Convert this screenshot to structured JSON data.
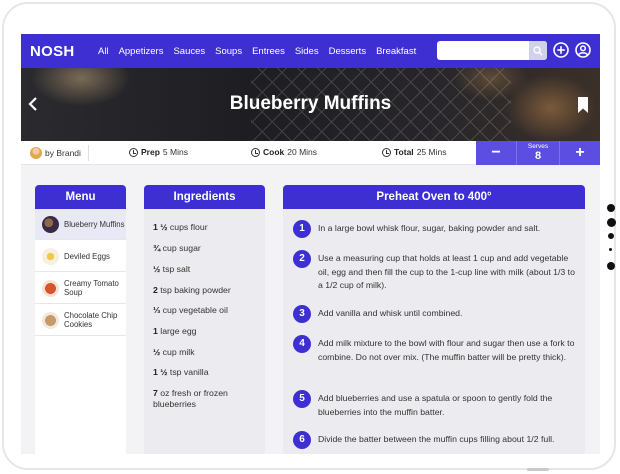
{
  "app": {
    "logo": "NOSH"
  },
  "nav": {
    "links": [
      "All",
      "Appetizers",
      "Sauces",
      "Soups",
      "Entrees",
      "Sides",
      "Desserts",
      "Breakfast"
    ],
    "search_placeholder": ""
  },
  "hero": {
    "title": "Blueberry Muffins"
  },
  "meta": {
    "author": "by Brandi",
    "prep_label": "Prep",
    "prep_value": "5 Mins",
    "cook_label": "Cook",
    "cook_value": "20 Mins",
    "total_label": "Total",
    "total_value": "25 Mins",
    "serves_label": "Serves",
    "serves_value": "8",
    "minus": "−",
    "plus": "+"
  },
  "menu": {
    "title": "Menu",
    "items": [
      {
        "label": "Blueberry Muffins",
        "active": true,
        "thumb_color": "#3b2a44"
      },
      {
        "label": "Deviled Eggs",
        "active": false,
        "thumb_color": "#e8b23a"
      },
      {
        "label": "Creamy Tomato Soup",
        "active": false,
        "thumb_color": "#c74a2a"
      },
      {
        "label": "Chocolate Chip Cookies",
        "active": false,
        "thumb_color": "#b98a5e"
      }
    ]
  },
  "ingredients": {
    "title": "Ingredients",
    "items": [
      {
        "qty": "1 ½",
        "text": "cups flour"
      },
      {
        "qty": "¾",
        "text": "cup sugar"
      },
      {
        "qty": "½",
        "text": "tsp salt"
      },
      {
        "qty": "2",
        "text": "tsp baking powder"
      },
      {
        "qty": "⅓",
        "text": "cup vegetable oil"
      },
      {
        "qty": "1",
        "text": " large egg"
      },
      {
        "qty": "½",
        "text": "cup milk"
      },
      {
        "qty": "1 ½",
        "text": " tsp vanilla"
      },
      {
        "qty": "7",
        "text": "oz fresh or frozen blueberries"
      }
    ]
  },
  "steps": {
    "title": "Preheat Oven to 400°",
    "items": [
      {
        "num": "1",
        "text": "In a large bowl whisk flour, sugar, baking powder and salt."
      },
      {
        "num": "2",
        "text": "Use a measuring cup that holds at least 1 cup and add vegetable oil, egg and then fill the cup to the 1-cup line with milk (about 1/3 to a 1/2 cup of milk)."
      },
      {
        "num": "3",
        "text": "Add vanilla and whisk until combined."
      },
      {
        "num": "4",
        "text": "Add milk mixture to the bowl with flour and sugar then use a fork to combine. Do not over mix. (The muffin batter will be pretty thick)."
      },
      {
        "num": "5",
        "text": "Add blueberries and use a spatula or spoon to gently fold the blueberries into the muffin batter."
      },
      {
        "num": "6",
        "text": "Divide the batter between the muffin cups filling about 1/2 full."
      }
    ]
  },
  "colors": {
    "brand": "#3d2fd2",
    "serves": "#5b4ee0"
  }
}
